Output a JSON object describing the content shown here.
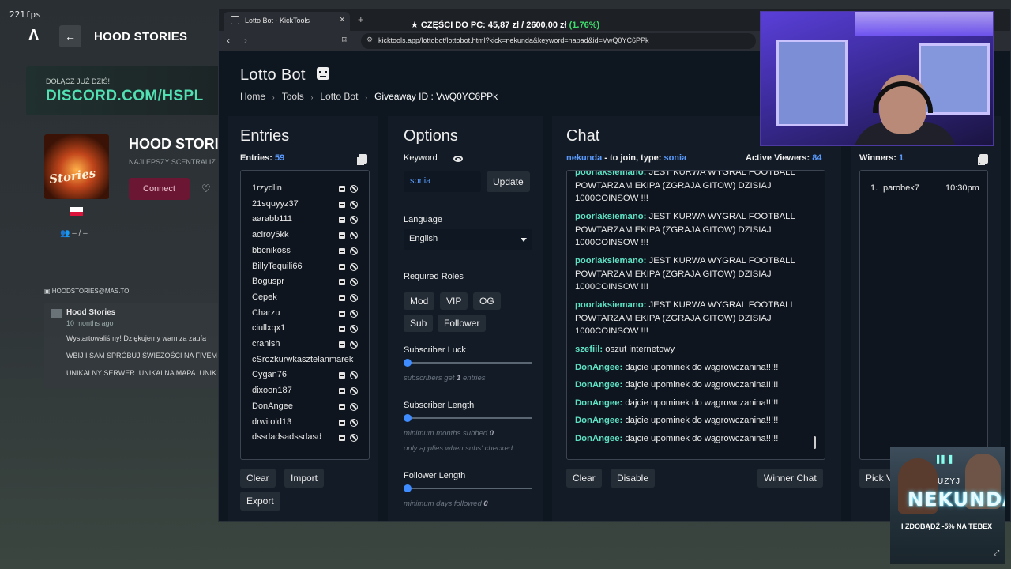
{
  "fps": "221fps",
  "launcher": {
    "title": "HOOD STORIES",
    "discord_small": "DOŁĄCZ JUŻ DZIŚ!",
    "discord_big": "DISCORD.COM/HSPL",
    "server_name": "HOOD STORI",
    "server_sub": "NAJLEPSZY SCENTRALIZ",
    "server_thumb_text": "Stories",
    "connect_label": "Connect",
    "players": "– / –",
    "news_header": "HOODSTORIES@MAS.TO",
    "news_author": "Hood Stories",
    "news_time": "10 months ago",
    "news_lines": [
      "Wystartowaliśmy! Dziękujemy wam za zaufa",
      "WBIJ I SAM SPRÓBUJ ŚWIEŻOŚCI NA FIVEM",
      "UNIKALNY SERWER. UNIKALNA MAPA. UNIK"
    ]
  },
  "overlay": {
    "price_label": "★ CZĘŚCI DO PC:",
    "price_current": "45,87 zł",
    "price_sep": "/",
    "price_goal": "2600,00 zł",
    "price_pct": "(1.76%)"
  },
  "browser": {
    "tab_title": "Lotto Bot - KickTools",
    "tab_close": "×",
    "tab_new": "+",
    "url": "kicktools.app/lottobot/lottobot.html?kick=nekunda&keyword=napad&id=VwQ0YC6PPk"
  },
  "page": {
    "title": "Lotto Bot",
    "breadcrumb": [
      "Home",
      "Tools",
      "Lotto Bot"
    ],
    "breadcrumb_sep": "›",
    "giveaway_label": "Giveaway ID :",
    "giveaway_id": "VwQ0YC6PPk"
  },
  "entries": {
    "heading": "Entries",
    "count_label": "Entries:",
    "count": "59",
    "items": [
      "1rzydlin",
      "21squyyz37",
      "aarabb111",
      "aciroy6kk",
      "bbcnikoss",
      "BillyTequili66",
      "Boguspr",
      "Cepek",
      "Charzu",
      "ciullxqx1",
      "cranish",
      "cSrozkurwkasztelanmarek",
      "Cygan76",
      "dixoon187",
      "DonAngee",
      "drwitold13",
      "dssdadsadssdasd"
    ],
    "buttons": {
      "clear": "Clear",
      "import": "Import",
      "export": "Export"
    }
  },
  "options": {
    "heading": "Options",
    "keyword_label": "Keyword",
    "keyword_value": "sonia",
    "update_label": "Update",
    "language_label": "Language",
    "language_value": "English",
    "roles_label": "Required Roles",
    "roles": [
      "Mod",
      "VIP",
      "OG",
      "Sub",
      "Follower"
    ],
    "sub_luck_label": "Subscriber Luck",
    "sub_luck_hint_pre": "subscribers get",
    "sub_luck_hint_val": "1",
    "sub_luck_hint_post": "entries",
    "sub_length_label": "Subscriber Length",
    "sub_length_hint_pre": "minimum months subbed",
    "sub_length_hint_val": "0",
    "sub_length_hint2": "only applies when subs' checked",
    "follow_length_label": "Follower Length",
    "follow_length_hint_pre": "minimum days followed",
    "follow_length_hint_val": "0"
  },
  "chat": {
    "heading": "Chat",
    "channel": "nekunda",
    "join_text": "- to join, type:",
    "keyword": "sonia",
    "viewers_label": "Active Viewers:",
    "viewers": "84",
    "messages": [
      {
        "user": "poorlaksiemano:",
        "text": "JEST KURWA WYGRAL FOOTBALL POWTARZAM EKIPA (ZGRAJA GITOW) DZISIAJ 1000COINSOW !!!"
      },
      {
        "user": "poorlaksiemano:",
        "text": "JEST KURWA WYGRAL FOOTBALL POWTARZAM EKIPA (ZGRAJA GITOW) DZISIAJ 1000COINSOW !!!"
      },
      {
        "user": "poorlaksiemano:",
        "text": "JEST KURWA WYGRAL FOOTBALL POWTARZAM EKIPA (ZGRAJA GITOW) DZISIAJ 1000COINSOW !!!"
      },
      {
        "user": "poorlaksiemano:",
        "text": "JEST KURWA WYGRAL FOOTBALL POWTARZAM EKIPA (ZGRAJA GITOW) DZISIAJ 1000COINSOW !!!"
      },
      {
        "user": "szefiil:",
        "text": "oszut internetowy"
      },
      {
        "user": "DonAngee:",
        "text": "dajcie upominek do wągrowczanina!!!!!"
      },
      {
        "user": "DonAngee:",
        "text": "dajcie upominek do wągrowczanina!!!!!"
      },
      {
        "user": "DonAngee:",
        "text": "dajcie upominek do wągrowczanina!!!!!"
      },
      {
        "user": "DonAngee:",
        "text": "dajcie upominek do wągrowczanina!!!!!"
      },
      {
        "user": "DonAngee:",
        "text": "dajcie upominek do wągrowczanina!!!!!"
      }
    ],
    "buttons": {
      "clear": "Clear",
      "disable": "Disable",
      "winner_chat": "Winner Chat"
    }
  },
  "winners": {
    "count_label": "Winners:",
    "count": "1",
    "items": [
      {
        "rank": "1.",
        "name": "parobek7",
        "time": "10:30pm"
      }
    ],
    "pick_label": "Pick V"
  },
  "ad": {
    "use": "UŻYJ",
    "name": "NEKUNDA",
    "promo": "I ZDOBĄDŹ -5% NA TEBEX"
  },
  "colors": {
    "accent_blue": "#5a9bff",
    "chat_user": "#5ee0c4",
    "connect_bg": "#6b1633",
    "discord_green": "#51e0b2"
  }
}
